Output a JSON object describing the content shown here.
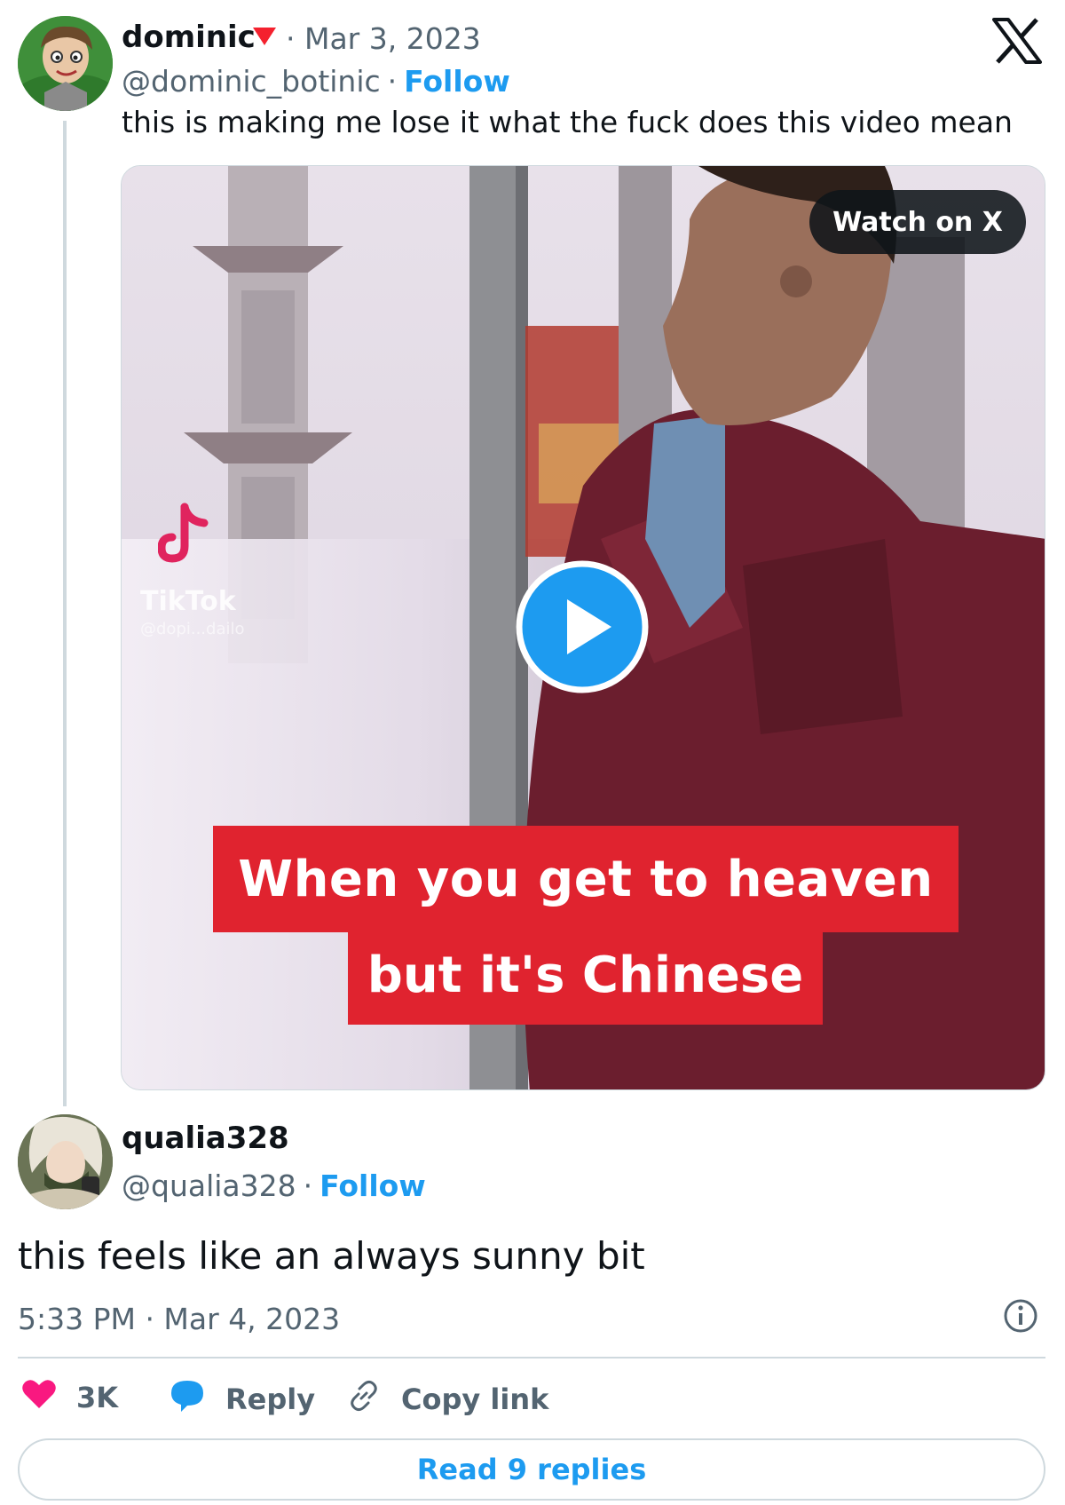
{
  "parent_tweet": {
    "display_name": "dominic",
    "date": "· Mar 3, 2023",
    "handle": "@dominic_botinic",
    "separator": "·",
    "follow_label": "Follow",
    "text": "this is making me lose it what the fuck does this video mean",
    "badge_icon": "red-triangle-badge-icon",
    "badge_color": "#f4212e"
  },
  "video": {
    "watch_label": "Watch on X",
    "caption_line_1": "When you get to heaven",
    "caption_line_2": "but it's Chinese",
    "watermark_label": "TikTok",
    "watermark_handle": "@dopi...dailo",
    "caption_color": "#e0232f",
    "play_color": "#1d9bf0"
  },
  "reply_tweet": {
    "display_name": "qualia328",
    "handle": "@qualia328",
    "separator": "·",
    "follow_label": "Follow",
    "text": "this feels like an always sunny bit",
    "timestamp": "5:33 PM · Mar 4, 2023"
  },
  "actions": {
    "like_count": "3K",
    "reply_label": "Reply",
    "copy_label": "Copy link",
    "read_replies_label": "Read 9 replies",
    "like_color": "#f91880",
    "reply_icon_color": "#1d9bf0",
    "accent": "#1d9bf0"
  },
  "branding": {
    "logo_icon": "x-logo-icon"
  }
}
